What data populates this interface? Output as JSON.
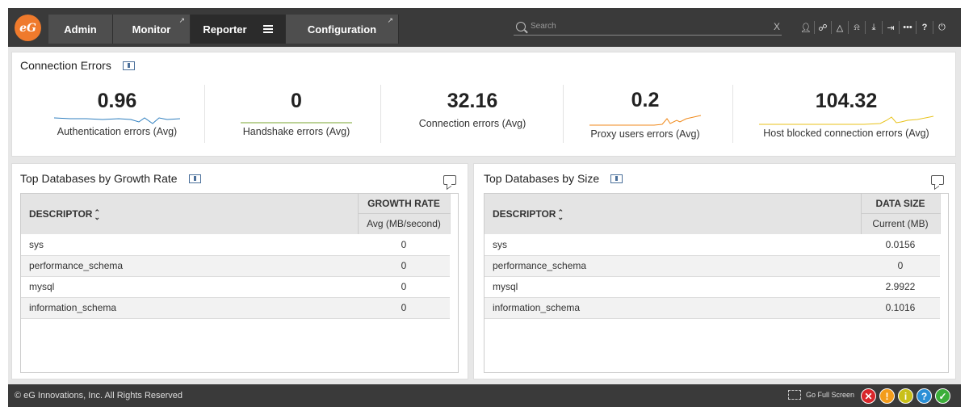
{
  "nav": {
    "logo": "eG",
    "tabs": [
      {
        "label": "Admin"
      },
      {
        "label": "Monitor"
      },
      {
        "label": "Reporter"
      },
      {
        "label": "Configuration"
      }
    ],
    "search_placeholder": "Search",
    "clear_label": "X",
    "tool_icons": [
      "user-icon",
      "link-icon",
      "alert-icon",
      "bell-icon",
      "download-icon",
      "logout-icon",
      "more-icon",
      "help-icon",
      "power-icon"
    ]
  },
  "connection_errors": {
    "title": "Connection Errors",
    "metrics": [
      {
        "value": "0.96",
        "label": "Authentication errors (Avg)",
        "spark_color": "#2f7fbf"
      },
      {
        "value": "0",
        "label": "Handshake errors (Avg)",
        "spark_color": "#7aa52f"
      },
      {
        "value": "32.16",
        "label": "Connection errors (Avg)",
        "spark_color": ""
      },
      {
        "value": "0.2",
        "label": "Proxy users errors (Avg)",
        "spark_color": "#f08a1c"
      },
      {
        "value": "104.32",
        "label": "Host blocked connection errors (Avg)",
        "spark_color": "#e8c21a"
      }
    ]
  },
  "growth_panel": {
    "title": "Top Databases by Growth Rate",
    "col_descriptor": "DESCRIPTOR",
    "col_metric": "GROWTH RATE",
    "col_sub": "Avg (MB/second)",
    "rows": [
      {
        "name": "sys",
        "value": "0"
      },
      {
        "name": "performance_schema",
        "value": "0"
      },
      {
        "name": "mysql",
        "value": "0"
      },
      {
        "name": "information_schema",
        "value": "0"
      }
    ]
  },
  "size_panel": {
    "title": "Top Databases by Size",
    "col_descriptor": "DESCRIPTOR",
    "col_metric": "DATA SIZE",
    "col_sub": "Current (MB)",
    "rows": [
      {
        "name": "sys",
        "value": "0.0156"
      },
      {
        "name": "performance_schema",
        "value": "0"
      },
      {
        "name": "mysql",
        "value": "2.9922"
      },
      {
        "name": "information_schema",
        "value": "0.1016"
      }
    ]
  },
  "footer": {
    "copyright": "© eG Innovations, Inc. All Rights Reserved",
    "fullscreen_label": "Go Full Screen",
    "status": [
      {
        "symbol": "✕",
        "color": "#d9262b"
      },
      {
        "symbol": "!",
        "color": "#f39c1b"
      },
      {
        "symbol": "i",
        "color": "#c9c01a"
      },
      {
        "symbol": "?",
        "color": "#2a8fd6"
      },
      {
        "symbol": "✓",
        "color": "#3cae3a"
      }
    ]
  }
}
